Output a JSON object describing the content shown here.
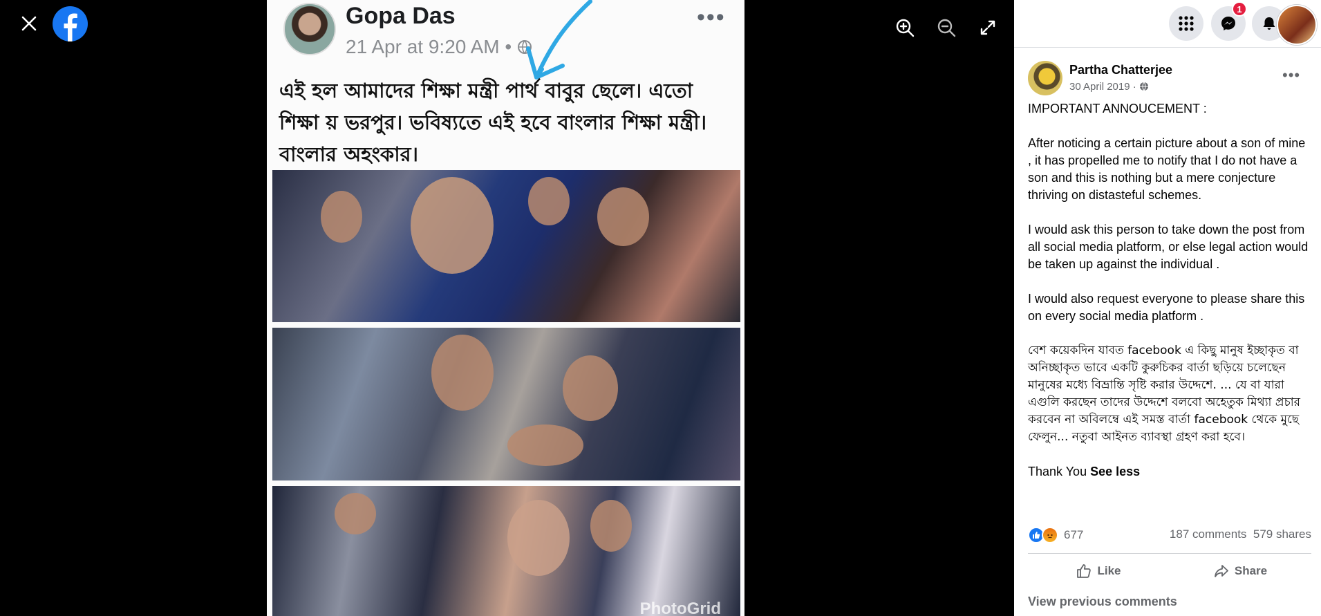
{
  "viewer": {
    "icons": {
      "close": "close-icon",
      "logo": "facebook-logo",
      "zoom_in": "zoom-in-icon",
      "zoom_out": "zoom-out-icon",
      "fullscreen": "fullscreen-icon"
    },
    "photo": {
      "author": "Gopa Das",
      "time": "21 Apr at 9:20 AM",
      "caption": "এই হল আমাদের শিক্ষা মন্ত্রী পার্থ বাবুর ছেলে। এতো শিক্ষা য় ভরপুর। ভবিষ্যতে এই হবে বাংলার শিক্ষা মন্ত্রী। বাংলার অহংকার।",
      "watermark": "PhotoGrid"
    }
  },
  "topbar": {
    "messenger_badge": "1",
    "icons": [
      "menu-grid-icon",
      "messenger-icon",
      "bell-icon"
    ]
  },
  "post": {
    "author": "Partha Chatterjee",
    "date": "30 April 2019 ·",
    "paragraphs": [
      "IMPORTANT ANNOUCEMENT :",
      "After noticing a certain picture about a son of mine , it has propelled me to notify that I do not have a son and this is nothing but a mere conjecture thriving on distasteful schemes.",
      "I would ask this person to take down the post from all social media platform, or else legal action would be taken up against the individual .",
      "I would also request everyone to please share this on every social media platform ."
    ],
    "bengali_paragraph": "বেশ কয়েকদিন যাবত facebook এ কিছু মানুষ ইচ্ছাকৃত বা অনিচ্ছাকৃত ভাবে একটি কুরুচিকর বার্তা ছড়িয়ে চলেছেন মানুষের মধ্যে বিভ্রান্তি সৃষ্টি করার উদ্দেশে. ... যে বা যারা এগুলি করছেন তাদের উদ্দেশে বলবো অহেতুক মিথ্যা প্রচার করবেন না অবিলম্বে এই সমস্ত বার্তা facebook থেকে মুছে ফেলুন... নতুবা আইনত ব্যাবস্থা গ্রহণ করা হবে।",
    "closing": "Thank You",
    "see_less": "See less",
    "reaction_count": "677",
    "comments": "187 comments",
    "shares": "579 shares",
    "like_label": "Like",
    "share_label": "Share",
    "view_previous": "View previous comments"
  }
}
